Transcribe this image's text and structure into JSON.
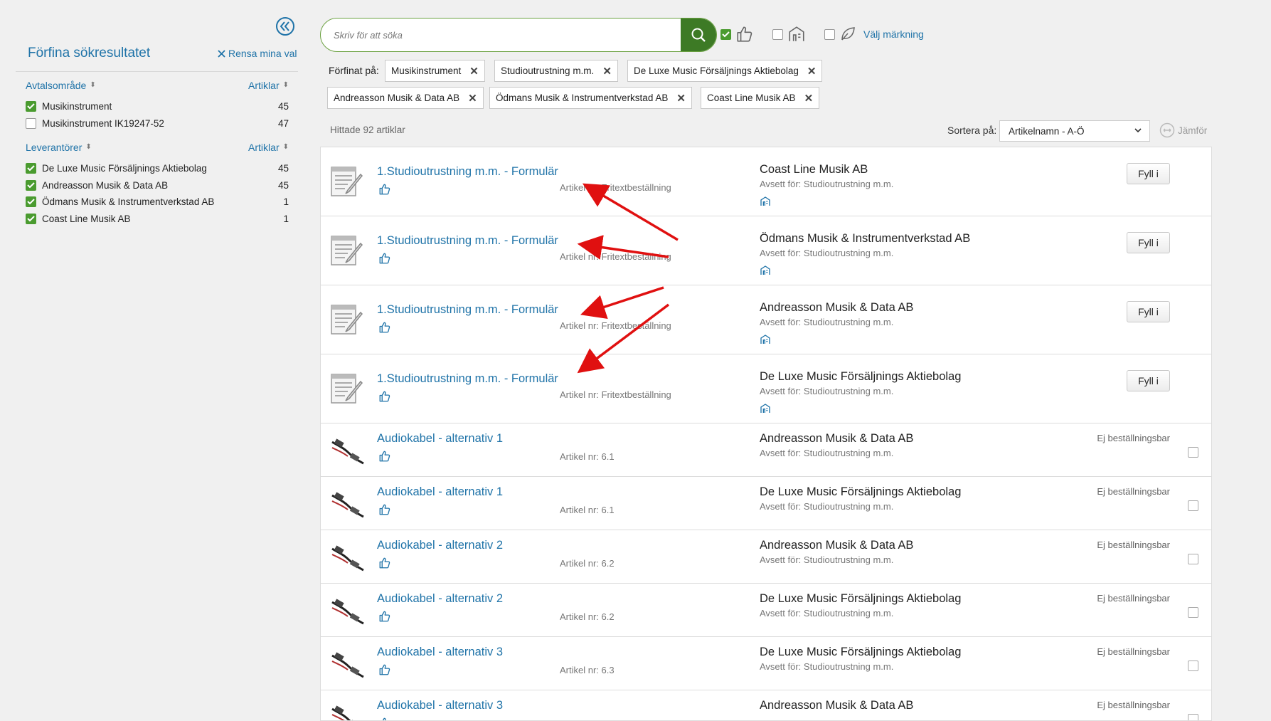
{
  "sidebar": {
    "title": "Förfina sökresultatet",
    "clear_label": "Rensa mina val",
    "sections": [
      {
        "title": "Avtalsområde",
        "count_header": "Artiklar",
        "items": [
          {
            "label": "Musikinstrument",
            "count": "45",
            "checked": true
          },
          {
            "label": "Musikinstrument IK19247-52",
            "count": "47",
            "checked": false
          }
        ]
      },
      {
        "title": "Leverantörer",
        "count_header": "Artiklar",
        "items": [
          {
            "label": "De Luxe Music Försäljnings Aktiebolag",
            "count": "45",
            "checked": true
          },
          {
            "label": "Andreasson Musik & Data AB",
            "count": "45",
            "checked": true
          },
          {
            "label": "Ödmans Musik & Instrumentverkstad AB",
            "count": "1",
            "checked": true
          },
          {
            "label": "Coast Line Musik AB",
            "count": "1",
            "checked": true
          }
        ]
      }
    ]
  },
  "search": {
    "placeholder": "Skriv för att söka"
  },
  "top_filters": {
    "label_choose": "Välj märkning"
  },
  "refined": {
    "label": "Förfinat på:",
    "chips": [
      "Musikinstrument",
      "Studioutrustning m.m.",
      "De Luxe Music Försäljnings Aktiebolag",
      "Andreasson Musik & Data AB",
      "Ödmans Musik & Instrumentverkstad AB",
      "Coast Line Musik AB"
    ]
  },
  "results": {
    "found_text": "Hittade 92 artiklar",
    "sort_label": "Sortera på:",
    "sort_value": "Artikelnamn - A-Ö",
    "compare_label": "Jämför",
    "rows": [
      {
        "name": "1.Studioutrustning m.m. - Formulär",
        "artnr": "Artikel nr: Fritextbeställning",
        "supplier": "Coast Line Musik AB",
        "for": "Avsett för: Studioutrustning m.m.",
        "action": "Fyll i",
        "thumb": "form-icon"
      },
      {
        "name": "1.Studioutrustning m.m. - Formulär",
        "artnr": "Artikel nr: Fritextbeställning",
        "supplier": "Ödmans Musik & Instrumentverkstad AB",
        "for": "Avsett för: Studioutrustning m.m.",
        "action": "Fyll i",
        "thumb": "form-icon"
      },
      {
        "name": "1.Studioutrustning m.m. - Formulär",
        "artnr": "Artikel nr: Fritextbeställning",
        "supplier": "Andreasson Musik & Data AB",
        "for": "Avsett för: Studioutrustning m.m.",
        "action": "Fyll i",
        "thumb": "form-icon"
      },
      {
        "name": "1.Studioutrustning m.m. - Formulär",
        "artnr": "Artikel nr: Fritextbeställning",
        "supplier": "De Luxe Music Försäljnings Aktiebolag",
        "for": "Avsett för: Studioutrustning m.m.",
        "action": "Fyll i",
        "thumb": "form-icon"
      },
      {
        "name": "Audiokabel - alternativ 1",
        "artnr": "Artikel nr: 6.1",
        "supplier": "Andreasson Musik & Data AB",
        "for": "Avsett för: Studioutrustning m.m.",
        "status": "Ej beställningsbar",
        "thumb": "cable-icon"
      },
      {
        "name": "Audiokabel - alternativ 1",
        "artnr": "Artikel nr: 6.1",
        "supplier": "De Luxe Music Försäljnings Aktiebolag",
        "for": "Avsett för: Studioutrustning m.m.",
        "status": "Ej beställningsbar",
        "thumb": "cable-icon"
      },
      {
        "name": "Audiokabel - alternativ 2",
        "artnr": "Artikel nr: 6.2",
        "supplier": "Andreasson Musik & Data AB",
        "for": "Avsett för: Studioutrustning m.m.",
        "status": "Ej beställningsbar",
        "thumb": "cable-icon"
      },
      {
        "name": "Audiokabel - alternativ 2",
        "artnr": "Artikel nr: 6.2",
        "supplier": "De Luxe Music Försäljnings Aktiebolag",
        "for": "Avsett för: Studioutrustning m.m.",
        "status": "Ej beställningsbar",
        "thumb": "cable-icon"
      },
      {
        "name": "Audiokabel - alternativ 3",
        "artnr": "Artikel nr: 6.3",
        "supplier": "De Luxe Music Försäljnings Aktiebolag",
        "for": "Avsett för: Studioutrustning m.m.",
        "status": "Ej beställningsbar",
        "thumb": "cable-icon"
      },
      {
        "name": "Audiokabel - alternativ 3",
        "artnr": "",
        "supplier": "Andreasson Musik & Data AB",
        "for": "",
        "status": "Ej beställningsbar",
        "thumb": "cable-icon"
      }
    ]
  },
  "colors": {
    "accent": "#1f73a8",
    "green": "#4a9b2f",
    "annotation": "#e01010"
  }
}
